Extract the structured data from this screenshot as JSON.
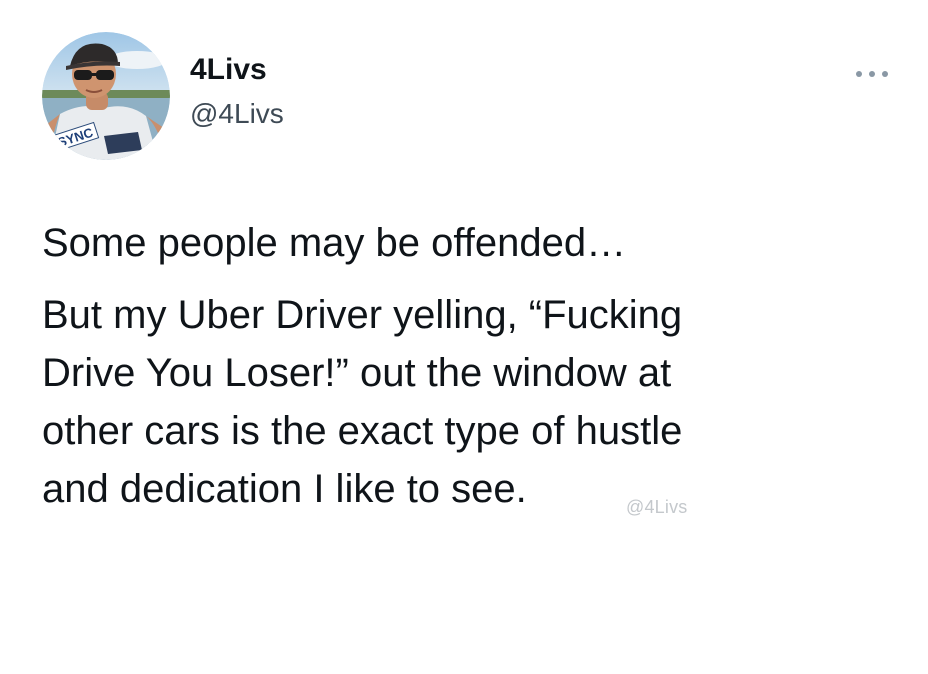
{
  "author": {
    "display_name": "4Livs",
    "handle": "@4Livs",
    "avatar_shirt_text": "SYNC"
  },
  "tweet": {
    "paragraph_1": "Some people may be offended…",
    "paragraph_2": "But my Uber Driver yelling, “Fucking\nDrive You Loser!” out the window at\nother cars is the exact type of hustle\nand dedication I like to see."
  },
  "watermark": "@4Livs",
  "icons": {
    "more": "more-horizontal-icon"
  }
}
